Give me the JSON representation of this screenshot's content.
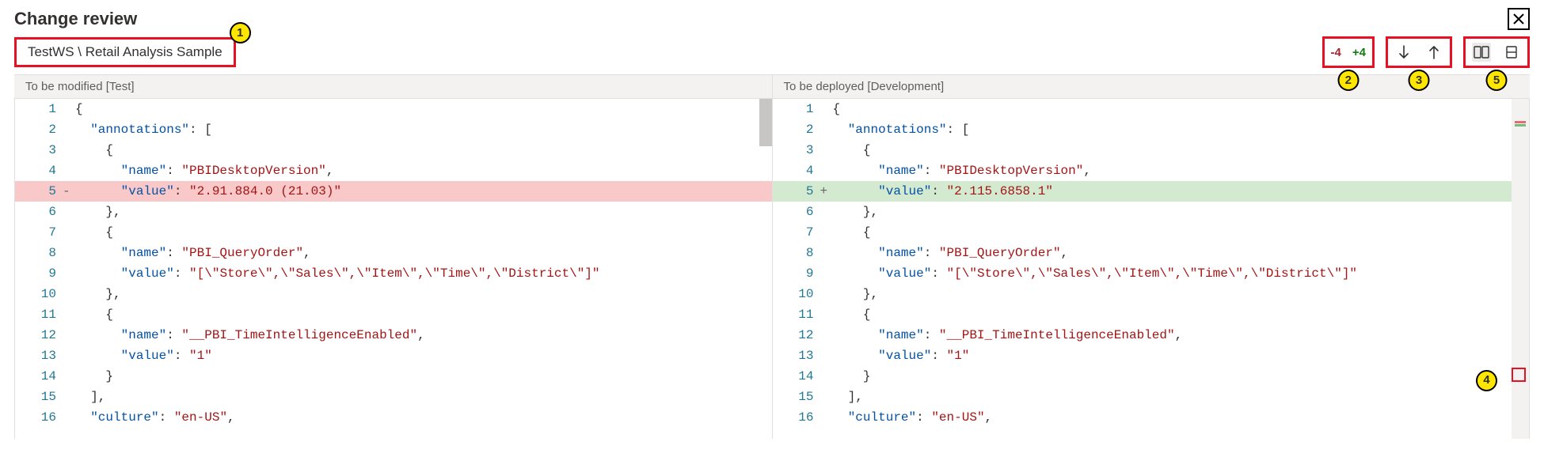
{
  "title": "Change review",
  "breadcrumb": "TestWS \\ Retail Analysis Sample",
  "callouts": {
    "c1": "1",
    "c2": "2",
    "c3": "3",
    "c4": "4",
    "c5": "5"
  },
  "diff_counts": {
    "removed": "-4",
    "added": "+4"
  },
  "icons": {
    "close": "close-icon",
    "nav_down": "arrow-down-icon",
    "nav_up": "arrow-up-icon",
    "view_sbs": "side-by-side-icon",
    "view_inline": "inline-view-icon"
  },
  "pane_left_header": "To be modified [Test]",
  "pane_right_header": "To be deployed [Development]",
  "left_lines": [
    {
      "n": 1,
      "m": "",
      "t": [
        [
          "brace",
          "{"
        ]
      ]
    },
    {
      "n": 2,
      "m": "",
      "t": [
        [
          "punc",
          "  "
        ],
        [
          "key",
          "\"annotations\""
        ],
        [
          "punc",
          ": ["
        ]
      ]
    },
    {
      "n": 3,
      "m": "",
      "t": [
        [
          "punc",
          "    {"
        ]
      ]
    },
    {
      "n": 4,
      "m": "",
      "t": [
        [
          "punc",
          "      "
        ],
        [
          "key",
          "\"name\""
        ],
        [
          "punc",
          ": "
        ],
        [
          "str",
          "\"PBIDesktopVersion\""
        ],
        [
          "punc",
          ","
        ]
      ]
    },
    {
      "n": 5,
      "m": "-",
      "cls": "line-removed",
      "t": [
        [
          "punc",
          "      "
        ],
        [
          "key",
          "\"value\""
        ],
        [
          "punc",
          ": "
        ],
        [
          "str",
          "\"2.91.884.0 (21.03)\""
        ]
      ]
    },
    {
      "n": 6,
      "m": "",
      "t": [
        [
          "punc",
          "    },"
        ]
      ]
    },
    {
      "n": 7,
      "m": "",
      "t": [
        [
          "punc",
          "    {"
        ]
      ]
    },
    {
      "n": 8,
      "m": "",
      "t": [
        [
          "punc",
          "      "
        ],
        [
          "key",
          "\"name\""
        ],
        [
          "punc",
          ": "
        ],
        [
          "str",
          "\"PBI_QueryOrder\""
        ],
        [
          "punc",
          ","
        ]
      ]
    },
    {
      "n": 9,
      "m": "",
      "t": [
        [
          "punc",
          "      "
        ],
        [
          "key",
          "\"value\""
        ],
        [
          "punc",
          ": "
        ],
        [
          "str",
          "\"[\\\"Store\\\",\\\"Sales\\\",\\\"Item\\\",\\\"Time\\\",\\\"District\\\"]\""
        ]
      ]
    },
    {
      "n": 10,
      "m": "",
      "t": [
        [
          "punc",
          "    },"
        ]
      ]
    },
    {
      "n": 11,
      "m": "",
      "t": [
        [
          "punc",
          "    {"
        ]
      ]
    },
    {
      "n": 12,
      "m": "",
      "t": [
        [
          "punc",
          "      "
        ],
        [
          "key",
          "\"name\""
        ],
        [
          "punc",
          ": "
        ],
        [
          "str",
          "\"__PBI_TimeIntelligenceEnabled\""
        ],
        [
          "punc",
          ","
        ]
      ]
    },
    {
      "n": 13,
      "m": "",
      "t": [
        [
          "punc",
          "      "
        ],
        [
          "key",
          "\"value\""
        ],
        [
          "punc",
          ": "
        ],
        [
          "str",
          "\"1\""
        ]
      ]
    },
    {
      "n": 14,
      "m": "",
      "t": [
        [
          "punc",
          "    }"
        ]
      ]
    },
    {
      "n": 15,
      "m": "",
      "t": [
        [
          "punc",
          "  ],"
        ]
      ]
    },
    {
      "n": 16,
      "m": "",
      "t": [
        [
          "punc",
          "  "
        ],
        [
          "key",
          "\"culture\""
        ],
        [
          "punc",
          ": "
        ],
        [
          "str",
          "\"en-US\""
        ],
        [
          "punc",
          ","
        ]
      ]
    }
  ],
  "right_lines": [
    {
      "n": 1,
      "m": "",
      "t": [
        [
          "brace",
          "{"
        ]
      ]
    },
    {
      "n": 2,
      "m": "",
      "t": [
        [
          "punc",
          "  "
        ],
        [
          "key",
          "\"annotations\""
        ],
        [
          "punc",
          ": ["
        ]
      ]
    },
    {
      "n": 3,
      "m": "",
      "t": [
        [
          "punc",
          "    {"
        ]
      ]
    },
    {
      "n": 4,
      "m": "",
      "t": [
        [
          "punc",
          "      "
        ],
        [
          "key",
          "\"name\""
        ],
        [
          "punc",
          ": "
        ],
        [
          "str",
          "\"PBIDesktopVersion\""
        ],
        [
          "punc",
          ","
        ]
      ]
    },
    {
      "n": 5,
      "m": "+",
      "cls": "line-added",
      "t": [
        [
          "punc",
          "      "
        ],
        [
          "key",
          "\"value\""
        ],
        [
          "punc",
          ": "
        ],
        [
          "str",
          "\"2.115.6858.1\""
        ]
      ]
    },
    {
      "n": 6,
      "m": "",
      "t": [
        [
          "punc",
          "    },"
        ]
      ]
    },
    {
      "n": 7,
      "m": "",
      "t": [
        [
          "punc",
          "    {"
        ]
      ]
    },
    {
      "n": 8,
      "m": "",
      "t": [
        [
          "punc",
          "      "
        ],
        [
          "key",
          "\"name\""
        ],
        [
          "punc",
          ": "
        ],
        [
          "str",
          "\"PBI_QueryOrder\""
        ],
        [
          "punc",
          ","
        ]
      ]
    },
    {
      "n": 9,
      "m": "",
      "t": [
        [
          "punc",
          "      "
        ],
        [
          "key",
          "\"value\""
        ],
        [
          "punc",
          ": "
        ],
        [
          "str",
          "\"[\\\"Store\\\",\\\"Sales\\\",\\\"Item\\\",\\\"Time\\\",\\\"District\\\"]\""
        ]
      ]
    },
    {
      "n": 10,
      "m": "",
      "t": [
        [
          "punc",
          "    },"
        ]
      ]
    },
    {
      "n": 11,
      "m": "",
      "t": [
        [
          "punc",
          "    {"
        ]
      ]
    },
    {
      "n": 12,
      "m": "",
      "t": [
        [
          "punc",
          "      "
        ],
        [
          "key",
          "\"name\""
        ],
        [
          "punc",
          ": "
        ],
        [
          "str",
          "\"__PBI_TimeIntelligenceEnabled\""
        ],
        [
          "punc",
          ","
        ]
      ]
    },
    {
      "n": 13,
      "m": "",
      "t": [
        [
          "punc",
          "      "
        ],
        [
          "key",
          "\"value\""
        ],
        [
          "punc",
          ": "
        ],
        [
          "str",
          "\"1\""
        ]
      ]
    },
    {
      "n": 14,
      "m": "",
      "t": [
        [
          "punc",
          "    }"
        ]
      ]
    },
    {
      "n": 15,
      "m": "",
      "t": [
        [
          "punc",
          "  ],"
        ]
      ]
    },
    {
      "n": 16,
      "m": "",
      "t": [
        [
          "punc",
          "  "
        ],
        [
          "key",
          "\"culture\""
        ],
        [
          "punc",
          ": "
        ],
        [
          "str",
          "\"en-US\""
        ],
        [
          "punc",
          ","
        ]
      ]
    }
  ]
}
